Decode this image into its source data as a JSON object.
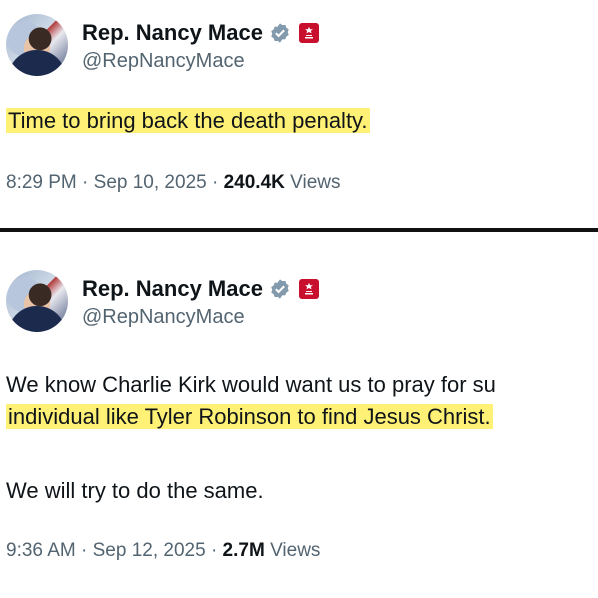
{
  "tweets": [
    {
      "author_name": "Rep. Nancy Mace",
      "handle": "@RepNancyMace",
      "text": "Time to bring back the death penalty.",
      "time": "8:29 PM",
      "date": "Sep 10, 2025",
      "views_count": "240.4K",
      "views_label": "Views"
    },
    {
      "author_name": "Rep. Nancy Mace",
      "handle": "@RepNancyMace",
      "text_line1": "We know Charlie Kirk would want us to pray for su",
      "text_line2": "individual like Tyler Robinson to find Jesus Christ.",
      "text_line3": "We will try to do the same.",
      "time": "9:36 AM",
      "date": "Sep 12, 2025",
      "views_count": "2.7M",
      "views_label": "Views"
    }
  ],
  "separator": "·",
  "colors": {
    "verified_badge": "#829aab",
    "gov_badge": "#c8102e",
    "highlight": "#ffeb3b",
    "secondary_text": "#536471"
  },
  "icons": [
    "avatar",
    "verified-badge-icon",
    "government-badge-icon"
  ]
}
